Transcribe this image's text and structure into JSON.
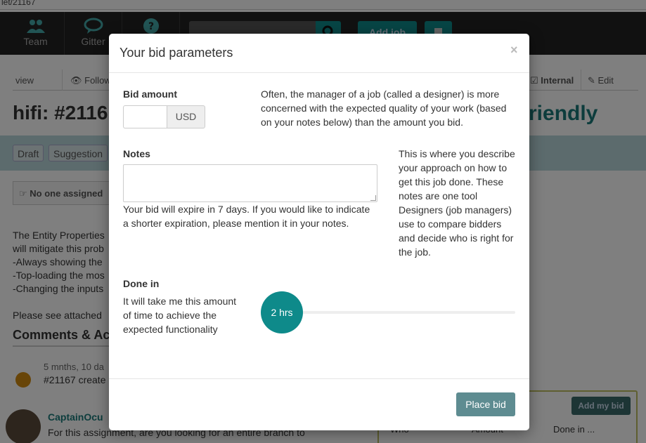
{
  "browser": {
    "url_fragment": "let/21167"
  },
  "nav": {
    "team_label": "Team",
    "gitter_label": "Gitter",
    "add_job_label": "Add job"
  },
  "page": {
    "bar": {
      "view": "view",
      "follow": "Follow",
      "internal": "Internal",
      "edit": "Edit"
    },
    "title": "hifi: #2116",
    "title_right": "riendly",
    "tags": [
      "Draft",
      "Suggestion"
    ],
    "assignee": "No one assigned",
    "desc_lines": [
      "The Entity Properties",
      "will mitigate this prob",
      "-Always showing the",
      "-Top-loading the mos",
      "-Changing the inputs"
    ],
    "attached": "Please see attached",
    "comments_heading": "Comments & Ac",
    "activity_time": "5 mnths, 10 da",
    "activity_text": "#21167 create",
    "commenter": "CaptainOcu",
    "comment_text": "For this assignment, are you looking for an entire branch to",
    "add_bid_label": "Add my bid",
    "bids_cols": {
      "who": "Who",
      "amount": "Amount",
      "done_in": "Done in ..."
    }
  },
  "modal": {
    "title": "Your bid parameters",
    "close": "×",
    "bid_amount_label": "Bid amount",
    "currency": "USD",
    "bid_amount_value": "",
    "bid_help": [
      "Often, the manager of a job (called a designer) is more",
      "concerned with the expected quality of your work (based",
      "on your notes below) than the amount you bid."
    ],
    "notes_label": "Notes",
    "notes_value": "",
    "notes_help": [
      "Your bid will expire in 7 days. If you would like to indicate",
      "a shorter expiration, please mention it in your notes."
    ],
    "notes_side_help": [
      "This is where you describe",
      "your approach on how to",
      "get this job done. These",
      "notes are one tool",
      "Designers (job managers)",
      "use to compare bidders",
      "and decide who is right for",
      "the job."
    ],
    "done_in_label": "Done in",
    "done_in_help": [
      "It will take me this amount",
      "of time to achieve the",
      "expected functionality"
    ],
    "done_in_value": "2 hrs",
    "place_bid_label": "Place bid"
  },
  "colors": {
    "teal": "#0e8a8a",
    "place_bid": "#5e8c91",
    "nav_bg": "#222222"
  }
}
